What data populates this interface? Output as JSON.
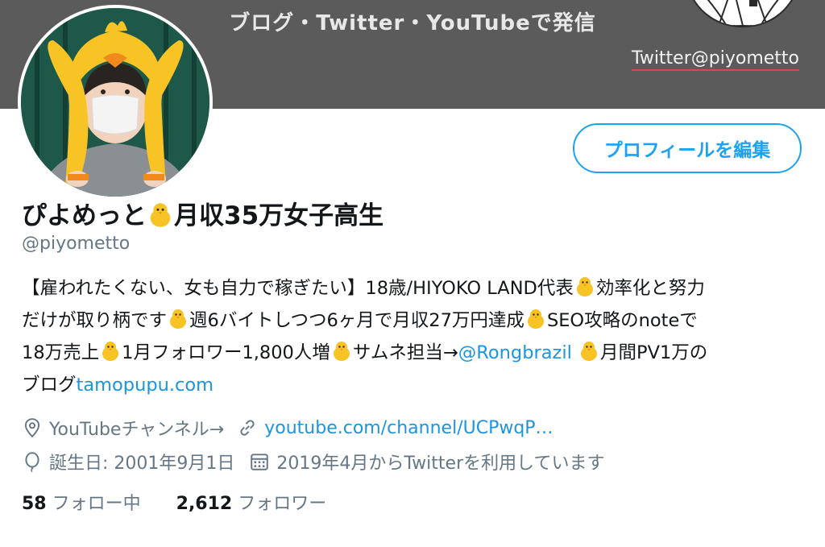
{
  "header": {
    "tagline": "ブログ・Twitter・YouTubeで発信",
    "twitter_handle": "Twitter@piyometto"
  },
  "profile": {
    "edit_button": "プロフィールを編集",
    "name_before": "ぴよめっと",
    "name_after": "月収35万女子高生",
    "handle": "@piyometto"
  },
  "bio": {
    "l1a": "【雇われたくない、女も自力で稼ぎたい】18歳/HIYOKO LAND代表",
    "l1b": "効率化と努力",
    "l2a": "だけが取り柄です",
    "l2b": "週6バイトしつつ6ヶ月で月収27万円達成",
    "l2c": "SEO攻略のnoteで",
    "l3a": "18万売上",
    "l3b": "1月フォロワー1,800人増",
    "l3c": "サムネ担当→",
    "l3mention": "@Rongbrazil",
    "l3d": "月間PV1万の",
    "l4a": "ブログ",
    "l4link": "tamopupu.com"
  },
  "meta": {
    "location": "YouTubeチャンネル→",
    "url": "youtube.com/channel/UCPwqP…",
    "birthday": "誕生日: 2001年9月1日",
    "joined": "2019年4月からTwitterを利用しています"
  },
  "stats": {
    "following_count": "58",
    "following_label": "フォロー中",
    "followers_count": "2,612",
    "followers_label": "フォロワー"
  },
  "colors": {
    "accent": "#1da1f2",
    "link": "#1b95e0",
    "muted": "#657786",
    "header_bg": "#5b5b5b"
  },
  "icons": [
    "location-icon",
    "link-icon",
    "balloon-icon",
    "calendar-icon",
    "chick-emoji-icon"
  ]
}
